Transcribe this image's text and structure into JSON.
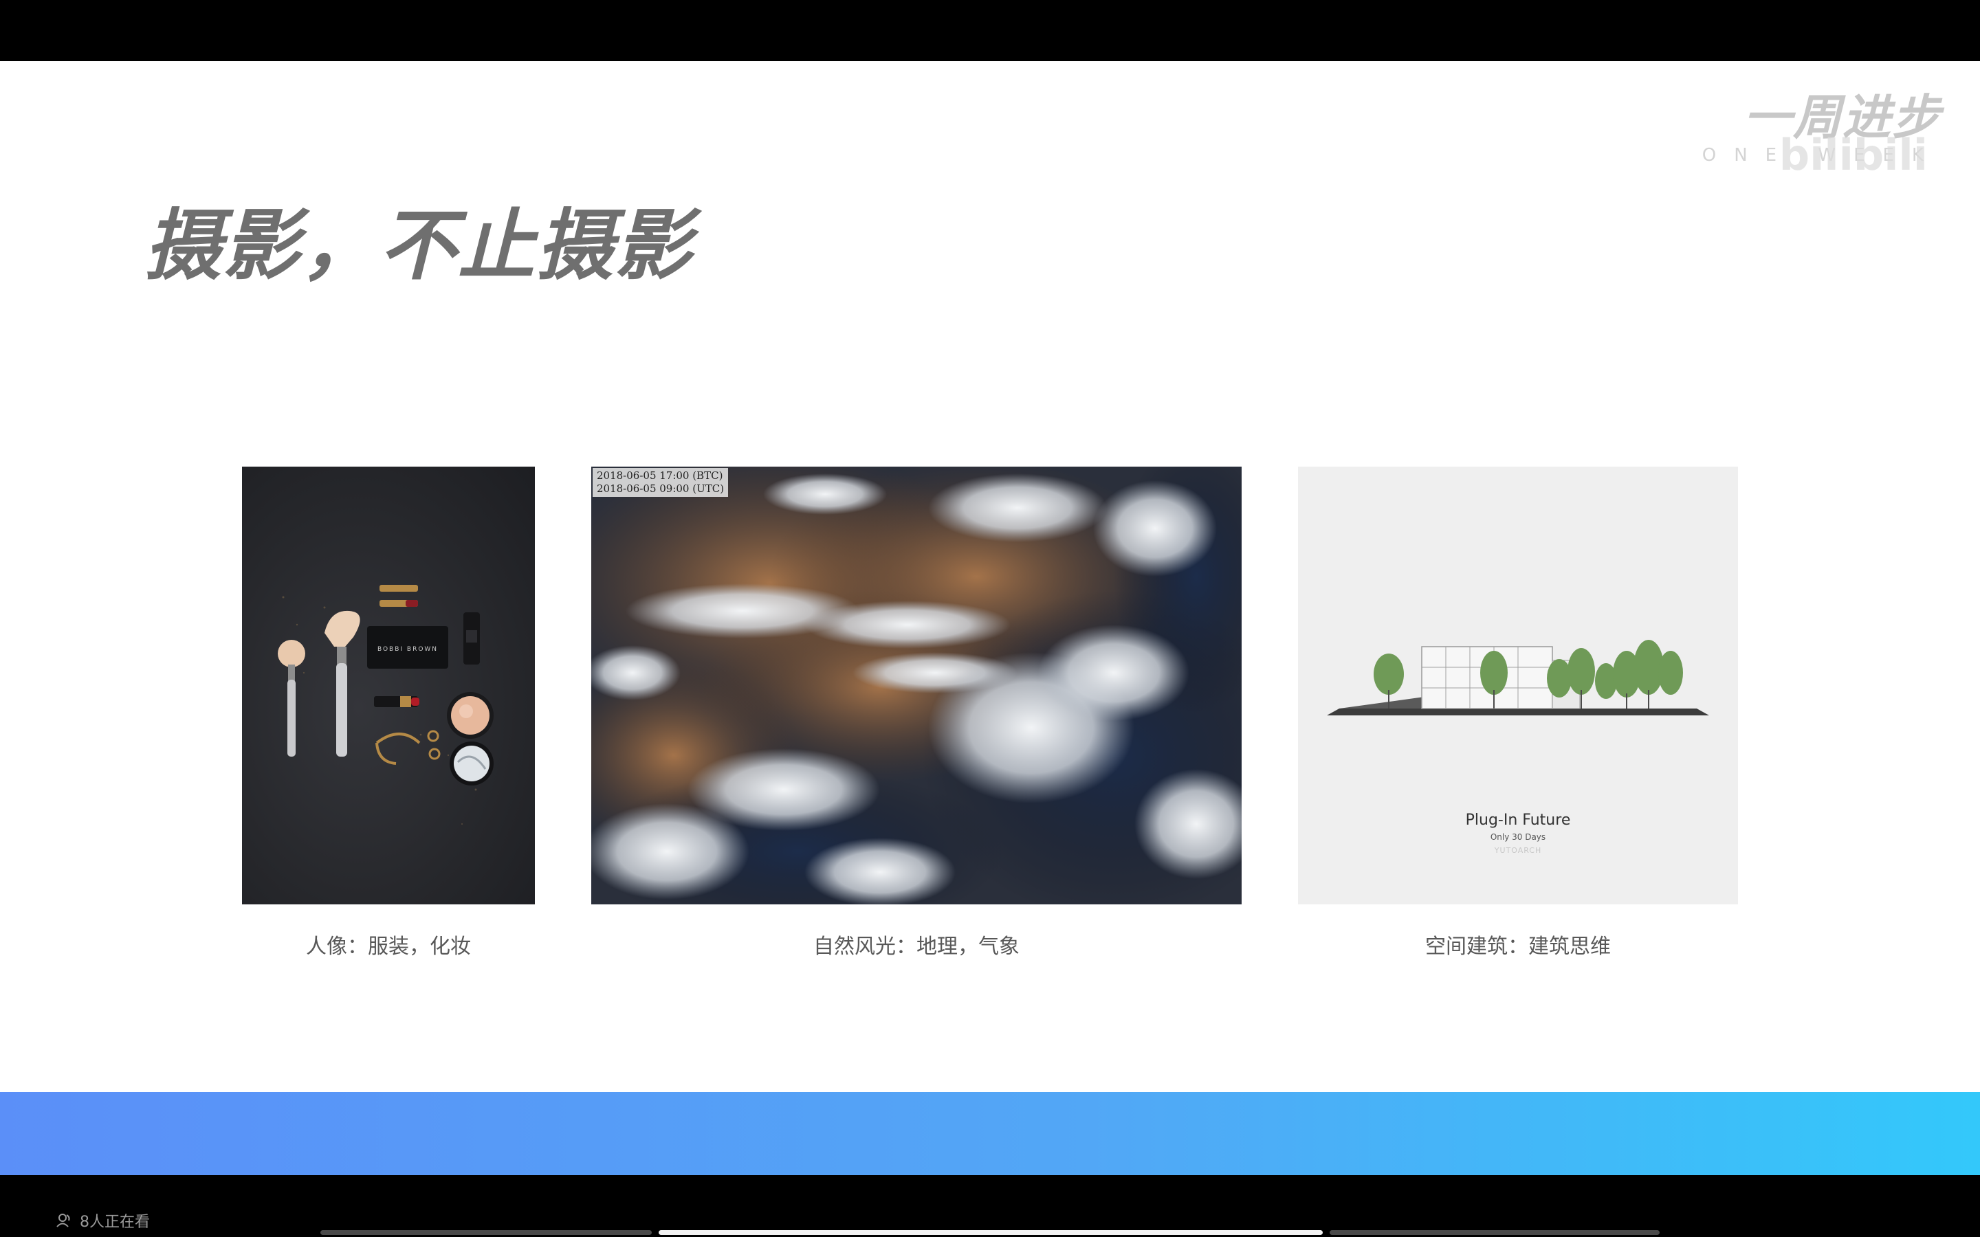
{
  "logo": {
    "main": "一周进步",
    "sub": "ONE WEEK",
    "watermark": "bilibili"
  },
  "slide": {
    "title": "摄影，不止摄影"
  },
  "cards": [
    {
      "caption": "人像：服装，化妆"
    },
    {
      "caption": "自然风光：地理，气象",
      "stamp_line1": "2018-06-05 17:00 (BTC)",
      "stamp_line2": "2018-06-05 09:00 (UTC)"
    },
    {
      "caption": "空间建筑：建筑思维",
      "inner_title": "Plug-In Future",
      "inner_sub": "Only 30 Days",
      "inner_brand": "YUTOARCH"
    }
  ],
  "player": {
    "viewers": "8人正在看",
    "progress_segments": 3,
    "active_segment": 2
  },
  "colors": {
    "bar_gradient_start": "#5b8ff8",
    "bar_gradient_end": "#33c8fa",
    "title_gray": "#6f6f6f"
  }
}
